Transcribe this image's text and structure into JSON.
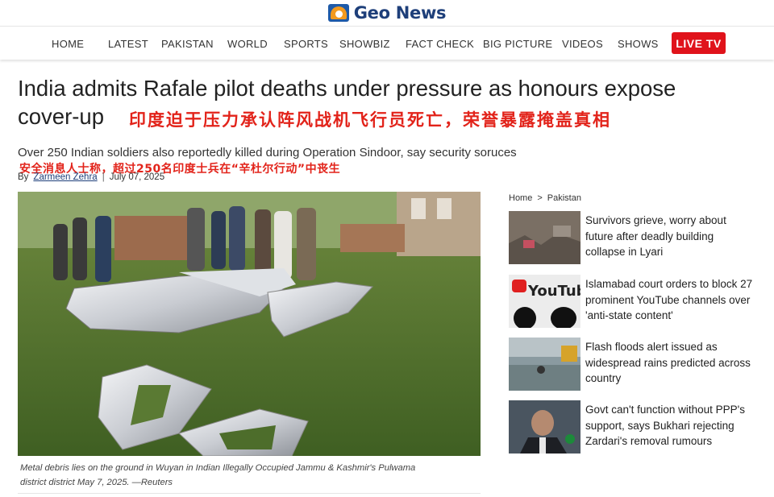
{
  "brand": {
    "name": "Geo News",
    "logo_icon": "geo-logo-icon"
  },
  "nav": {
    "items": [
      "HOME",
      "LATEST",
      "PAKISTAN",
      "WORLD",
      "SPORTS",
      "SHOWBIZ",
      "FACT CHECK",
      "BIG PICTURE",
      "VIDEOS",
      "SHOWS"
    ],
    "live": "LIVE TV",
    "live_color": "#e0131b"
  },
  "article": {
    "headline_line1": "India admits Rafale pilot deaths under pressure as honours expose",
    "headline_line2": "cover-up",
    "zh_title": "印度迫于压力承认阵风战机飞行员死亡，荣誉暴露掩盖真相",
    "subhead": "Over 250 Indian soldiers also reportedly killed during Operation Sindoor, say security soruces",
    "zh_sub": "安全消息人士称，超过250名印度士兵在“辛杜尔行动”中丧生",
    "by": "By",
    "author": "Zarmeen Zehra",
    "separator": "|",
    "date": "July 07, 2025",
    "caption_line1": "Metal debris lies on the ground in Wuyan in Indian Illegally Occupied Jammu & Kashmir's Pulwama",
    "caption_line2": "district district May 7, 2025. —Reuters",
    "accent_red": "#e2231a"
  },
  "sidebar": {
    "crumb_home": "Home",
    "crumb_sep": ">",
    "crumb_section": "Pakistan",
    "stories": [
      {
        "title": "Survivors grieve, worry about future after deadly building collapse in Lyari"
      },
      {
        "title": "Islamabad court orders to block 27 prominent YouTube channels over 'anti-state content'"
      },
      {
        "title": "Flash floods alert issued as widespread rains predicted across country"
      },
      {
        "title": "Govt can't function without PPP's support, says Bukhari rejecting Zardari's removal rumours"
      }
    ]
  }
}
